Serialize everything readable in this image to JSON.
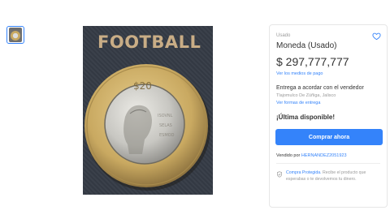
{
  "gallery": {
    "image_print_text": "FOOTBALL"
  },
  "product": {
    "condition": "Usado",
    "title": "Moneda (Usado)",
    "price": "$ 297,777,777",
    "payment_link": "Ver los medios de pago",
    "delivery": "Entrega a acordar con el vendedor",
    "location": "Tlajomulco De Zúñiga, Jalisco",
    "delivery_link": "Ver formas de entrega",
    "availability": "¡Última disponible!",
    "buy_button": "Comprar ahora",
    "seller_prefix": "Vendido por ",
    "seller_name": "HERNANDEZ2051923",
    "protected_link": "Compra Protegida.",
    "protected_text": " Recibe el producto que esperabas o te devolvemos tu dinero."
  },
  "colors": {
    "accent": "#3483fa",
    "coin_ring": "#c9a961",
    "coin_center": "#d9d9d4",
    "photo_background": "#353b45"
  },
  "icons": {
    "favorite": "heart-outline-icon",
    "protection": "shield-check-icon"
  }
}
